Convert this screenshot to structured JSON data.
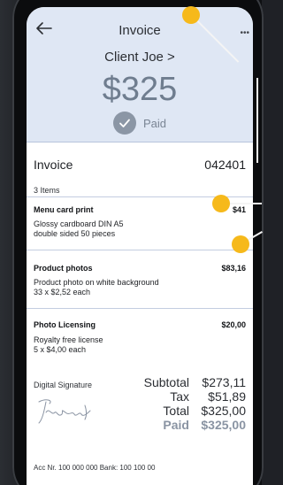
{
  "header": {
    "title": "Invoice",
    "client": "Client Joe >",
    "amount": "$325",
    "status": "Paid",
    "more": "•••"
  },
  "invoice": {
    "label": "Invoice",
    "number": "042401",
    "items_count": "3 Items"
  },
  "items": [
    {
      "name": "Menu card print",
      "price": "$41",
      "desc1": "Glossy cardboard DIN A5",
      "desc2": "double sided 50 pieces"
    },
    {
      "name": "Product photos",
      "price": "$83,16",
      "desc1": "Product photo on white background",
      "desc2": "33 x $2,52 each"
    },
    {
      "name": "Photo Licensing",
      "price": "$20,00",
      "desc1": "Royalty free license",
      "desc2": "5 x $4,00 each"
    }
  ],
  "signature": {
    "label": "Digital Signature"
  },
  "totals": {
    "subtotal_label": "Subtotal",
    "subtotal": "$273,11",
    "tax_label": "Tax",
    "tax": "$51,89",
    "total_label": "Total",
    "total": "$325,00",
    "paid_label": "Paid",
    "paid": "$325,00"
  },
  "footer": {
    "text": "Acc Nr. 100 000 000  Bank: 100 100 00"
  },
  "colors": {
    "header_bg": "#dfe7f4",
    "accent": "#6f7d8f",
    "callout_dot": "#f6b91b"
  }
}
